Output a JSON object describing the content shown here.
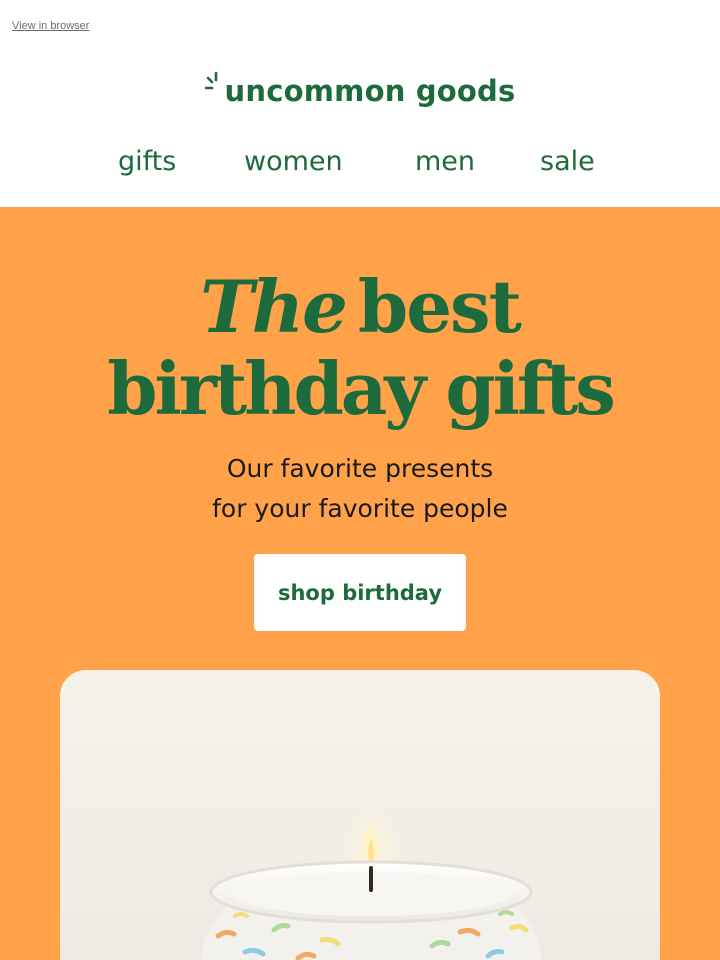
{
  "header": {
    "view_in_browser": "View in browser",
    "logo_text": "uncommon goods"
  },
  "nav": {
    "items": [
      {
        "label": "gifts"
      },
      {
        "label": "women"
      },
      {
        "label": "men"
      },
      {
        "label": "sale"
      }
    ]
  },
  "hero": {
    "headline_italic": "The",
    "headline_line1_rest": "best",
    "headline_line2": "birthday gifts",
    "subtitle_line1": "Our favorite presents",
    "subtitle_line2": "for your favorite people",
    "cta_label": "shop birthday"
  },
  "colors": {
    "brand_green": "#1d6b3c",
    "hero_orange": "#ffa24a",
    "cta_background": "#ffffff"
  },
  "icons": {
    "logo_mark": "sparkle-icon",
    "product_image": "candle-image"
  }
}
